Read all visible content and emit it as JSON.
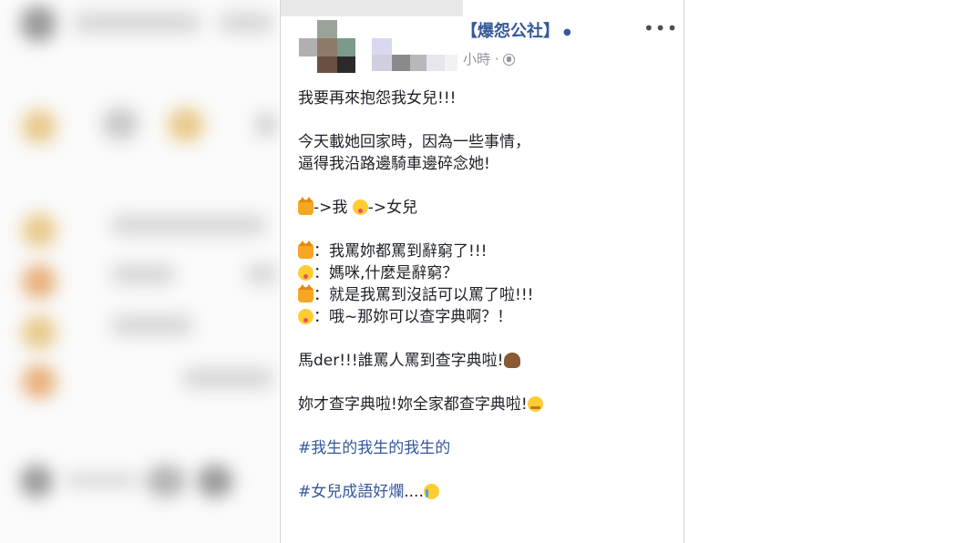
{
  "post": {
    "group_name": "【爆怨公社】",
    "group_dot": "●",
    "time_text": "小時 ·",
    "more_label": "•••",
    "lines": {
      "l1": "我要再來抱怨我女兒!!!",
      "l2a": "今天載她回家時，因為一些事情，",
      "l2b": "逼得我沿路邊騎車邊碎念她!",
      "l3a": "->我 ",
      "l3b": "->女兒",
      "d1": "：我罵妳都罵到辭窮了!!!",
      "d2": "：媽咪,什麼是辭窮？",
      "d3": "：就是我罵到沒話可以罵了啦!!!",
      "d4": "：哦~那妳可以查字典啊？！",
      "l5": "馬der!!!誰罵人罵到查字典啦!",
      "l6": "妳才查字典啦!妳全家都查字典啦!",
      "tag1": "#我生的我生的我生的",
      "tag2": "#女兒成語好爛"
    },
    "tag2_suffix": "....",
    "emoji_names": {
      "cat": "pouting-cat-icon",
      "face": "winking-tongue-face-icon",
      "poo": "pile-of-poo-icon",
      "steam": "face-with-steam-icon",
      "cry": "crying-face-icon"
    }
  },
  "colors": {
    "link": "#365899",
    "text": "#1d2129",
    "meta": "#90949c"
  }
}
